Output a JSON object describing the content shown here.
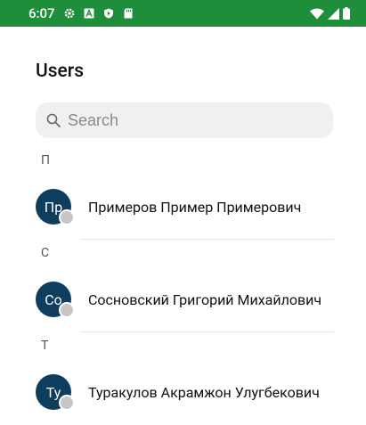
{
  "statusbar": {
    "time": "6:07",
    "left_icons": [
      "gear-icon",
      "a-icon",
      "play-shield-icon",
      "sd-card-icon"
    ],
    "right_icons": [
      "wifi-icon",
      "signal-icon",
      "battery-icon"
    ],
    "color": "#1f8e3a"
  },
  "page": {
    "title": "Users"
  },
  "search": {
    "placeholder": "Search",
    "value": ""
  },
  "sections": [
    {
      "letter": "П",
      "users": [
        {
          "initials": "Пр",
          "name": "Примеров Пример Примерович"
        }
      ]
    },
    {
      "letter": "С",
      "users": [
        {
          "initials": "Со",
          "name": "Сосновский Григорий Михайлович"
        }
      ]
    },
    {
      "letter": "Т",
      "users": [
        {
          "initials": "Ту",
          "name": "Туракулов Акрамжон Улугбекович"
        }
      ]
    }
  ],
  "colors": {
    "avatar": "#0e3d5e",
    "presence": "#c7c7c7"
  }
}
